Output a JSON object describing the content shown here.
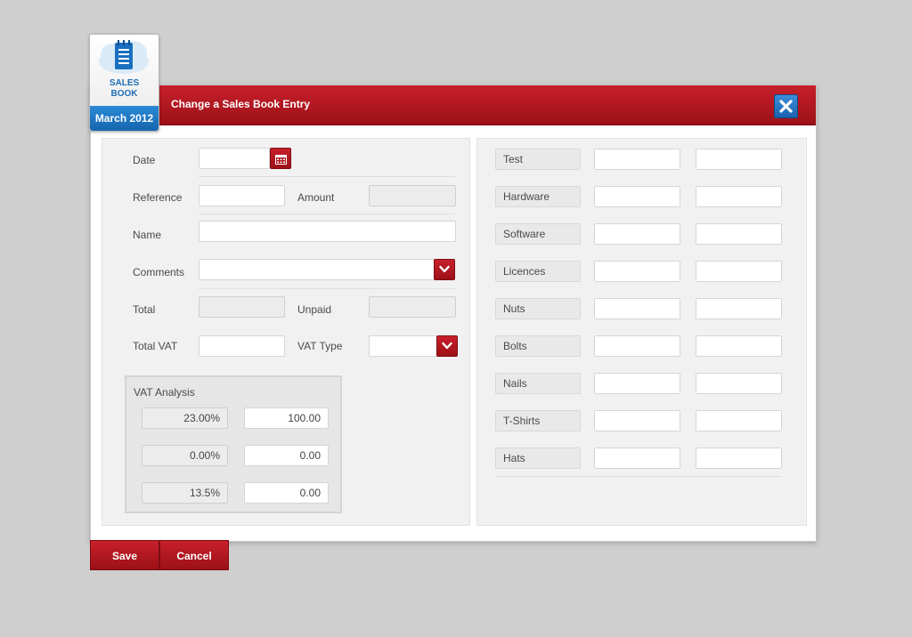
{
  "app": {
    "badge_label_line1": "SALES",
    "badge_label_line2": "BOOK",
    "period": "March 2012"
  },
  "dialog": {
    "title": "Change a Sales Book Entry"
  },
  "form": {
    "date_label": "Date",
    "date_value": "",
    "reference_label": "Reference",
    "reference_value": "",
    "amount_label": "Amount",
    "amount_value": "",
    "name_label": "Name",
    "name_value": "",
    "comments_label": "Comments",
    "comments_value": "",
    "total_label": "Total",
    "total_value": "",
    "unpaid_label": "Unpaid",
    "unpaid_value": "",
    "total_vat_label": "Total VAT",
    "total_vat_value": "",
    "vat_type_label": "VAT Type",
    "vat_type_value": ""
  },
  "vat_analysis": {
    "title": "VAT Analysis",
    "rows": [
      {
        "rate": "23.00%",
        "amount": "100.00"
      },
      {
        "rate": "0.00%",
        "amount": "0.00"
      },
      {
        "rate": "13.5%",
        "amount": "0.00"
      }
    ]
  },
  "categories": [
    {
      "label": "Test",
      "value1": "",
      "value2": ""
    },
    {
      "label": "Hardware",
      "value1": "",
      "value2": ""
    },
    {
      "label": "Software",
      "value1": "",
      "value2": ""
    },
    {
      "label": "Licences",
      "value1": "",
      "value2": ""
    },
    {
      "label": "Nuts",
      "value1": "",
      "value2": ""
    },
    {
      "label": "Bolts",
      "value1": "",
      "value2": ""
    },
    {
      "label": "Nails",
      "value1": "",
      "value2": ""
    },
    {
      "label": "T-Shirts",
      "value1": "",
      "value2": ""
    },
    {
      "label": "Hats",
      "value1": "",
      "value2": ""
    }
  ],
  "buttons": {
    "save": "Save",
    "cancel": "Cancel"
  },
  "colors": {
    "accent_red": "#b5151e",
    "accent_blue": "#1b6fbf"
  }
}
